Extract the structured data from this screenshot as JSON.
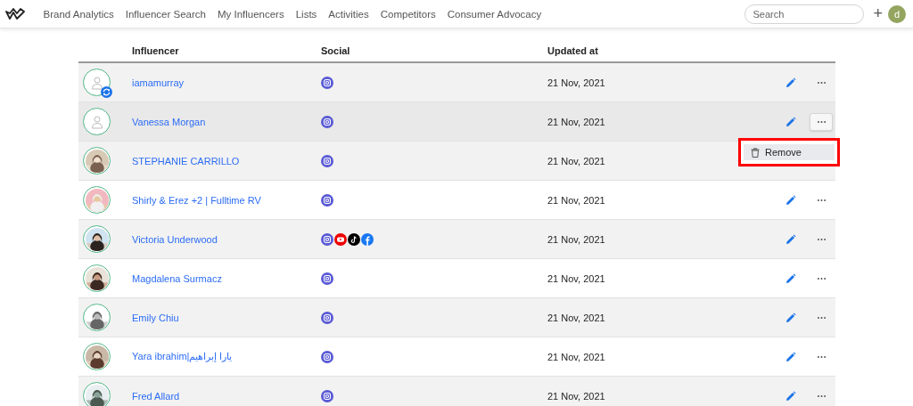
{
  "nav": {
    "items": [
      {
        "label": "Brand Analytics",
        "selected": false
      },
      {
        "label": "Influencer Search",
        "selected": false
      },
      {
        "label": "My Influencers",
        "selected": false
      },
      {
        "label": "Lists",
        "selected": false
      },
      {
        "label": "Activities",
        "selected": false
      },
      {
        "label": "Competitors",
        "selected": false
      },
      {
        "label": "Consumer Advocacy",
        "selected": false
      }
    ],
    "search": {
      "placeholder": "Search"
    },
    "add": "+",
    "avatar": "d"
  },
  "table": {
    "columns": [
      "Influencer",
      "Social",
      "Updated at"
    ],
    "rows": [
      {
        "avatar": {
          "kind": "placeholder",
          "syncing": true
        },
        "name": "iamamurray",
        "social": [
          {
            "kind": "instagram"
          }
        ],
        "updated": "21 Nov, 2021",
        "menu_open": false
      },
      {
        "avatar": {
          "kind": "placeholder",
          "syncing": false
        },
        "name": "Vanessa Morgan",
        "social": [
          {
            "kind": "instagram"
          }
        ],
        "updated": "21 Nov, 2021",
        "menu_open": true
      },
      {
        "name": "STEPHANIE CARRILLO",
        "social": [
          {
            "kind": "instagram"
          }
        ],
        "updated": "21 Nov, 2021",
        "menu_open": false
      },
      {
        "name": "Shirly & Erez +2 | Fulltime RV",
        "social": [
          {
            "kind": "instagram"
          }
        ],
        "updated": "21 Nov, 2021",
        "menu_open": false
      },
      {
        "name": "Victoria Underwood",
        "social": [
          {
            "kind": "instagram"
          },
          {
            "kind": "youtube"
          },
          {
            "kind": "tiktok"
          },
          {
            "kind": "facebook"
          }
        ],
        "updated": "21 Nov, 2021",
        "menu_open": false
      },
      {
        "name": "Magdalena Surmacz",
        "social": [
          {
            "kind": "instagram"
          }
        ],
        "updated": "21 Nov, 2021",
        "menu_open": false
      },
      {
        "name": "Emily Chiu",
        "social": [
          {
            "kind": "instagram"
          }
        ],
        "updated": "21 Nov, 2021",
        "menu_open": false
      },
      {
        "name": "Yara ibrahim|يارا إبراهيم",
        "social": [
          {
            "kind": "instagram"
          }
        ],
        "updated": "21 Nov, 2021",
        "menu_open": false
      },
      {
        "name": "Fred Allard",
        "social": [
          {
            "kind": "instagram"
          }
        ],
        "updated": "21 Nov, 2021",
        "menu_open": false
      }
    ]
  },
  "row_menu": {
    "items": [
      "Remove"
    ],
    "highlighted": true
  }
}
